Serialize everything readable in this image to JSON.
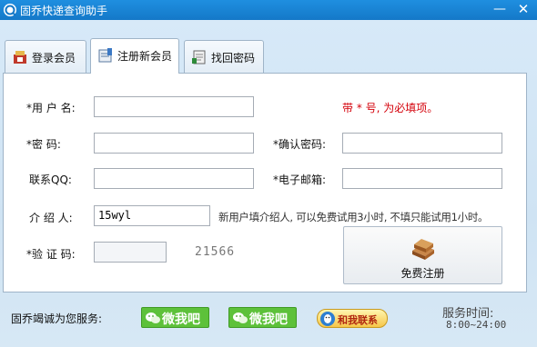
{
  "window": {
    "title": "固乔快递查询助手",
    "minimize": "—",
    "close": "✕"
  },
  "tabs": [
    {
      "label": "登录会员",
      "icon": "login-icon"
    },
    {
      "label": "注册新会员",
      "icon": "register-icon"
    },
    {
      "label": "找回密码",
      "icon": "recover-icon"
    }
  ],
  "form": {
    "username_label": "*用 户 名:",
    "password_label": "*密    码:",
    "confirm_label": "*确认密码:",
    "qq_label": "联系QQ:",
    "email_label": "*电子邮箱:",
    "referrer_label": "介 绍 人:",
    "referrer_value": "15wyl",
    "captcha_label": "*验 证 码:",
    "captcha_code": "21566",
    "required_note": "带 * 号, 为必填项。",
    "referrer_note": "新用户填介绍人, 可以免费试用3小时, 不填只能试用1小时。",
    "register_button": "免费注册"
  },
  "footer": {
    "service_label": "固乔竭诚为您服务:",
    "wechat_1": "微我吧",
    "wechat_2": "微我吧",
    "contact": "和我联系",
    "service_time_label": "服务时间:",
    "service_hours": "8:00~24:00"
  },
  "colors": {
    "titlebar": "#1a84d6",
    "required_red": "#d4000a",
    "wechat_green": "#5dc13a"
  }
}
